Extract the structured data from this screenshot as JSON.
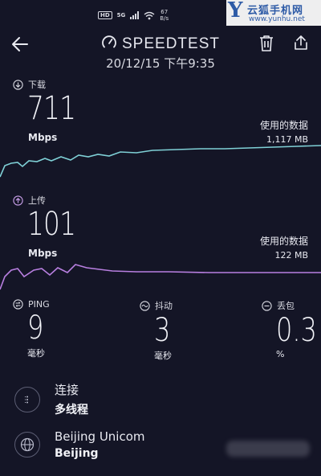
{
  "status_bar": {
    "hd": "HD",
    "network": "5G",
    "speed_value": "67",
    "speed_unit": "B/s"
  },
  "watermark": {
    "logo": "Y",
    "name": "云狐手机网",
    "url": "www.yunhu.net"
  },
  "header": {
    "brand": "SPEEDTEST",
    "datetime": "20/12/15 下午9:35"
  },
  "download": {
    "label": "下载",
    "value": "711",
    "unit": "Mbps",
    "data_label": "使用的数据",
    "data_value": "1,117 MB",
    "color": "#7fd0d6"
  },
  "upload": {
    "label": "上传",
    "value": "101",
    "unit": "Mbps",
    "data_label": "使用的数据",
    "data_value": "122 MB",
    "color": "#b87fe0"
  },
  "stats": {
    "ping": {
      "label": "PING",
      "value": "9",
      "unit": "毫秒"
    },
    "jitter": {
      "label": "抖动",
      "value": "3",
      "unit": "毫秒"
    },
    "loss": {
      "label": "丢包",
      "value": "0.3",
      "unit": "%"
    }
  },
  "connection": {
    "label": "连接",
    "value": "多线程"
  },
  "server": {
    "name": "Beijing Unicom",
    "city": "Beijing"
  }
}
